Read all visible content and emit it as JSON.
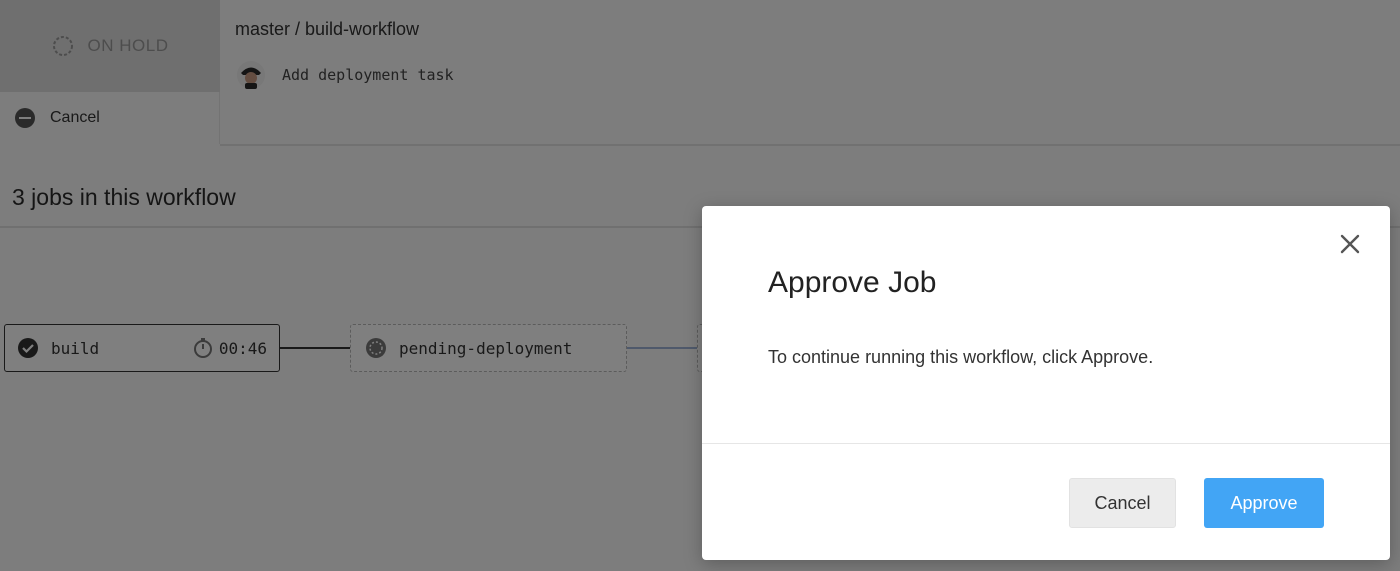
{
  "header": {
    "status_label": "ON HOLD",
    "cancel_label": "Cancel",
    "branch": "master / build-workflow",
    "commit_message": "Add deployment task"
  },
  "jobs_section": {
    "title": "3 jobs in this workflow",
    "jobs": [
      {
        "name": "build",
        "duration": "00:46",
        "status": "success"
      },
      {
        "name": "pending-deployment",
        "status": "on-hold"
      },
      {
        "name": "",
        "status": "blocked"
      }
    ]
  },
  "modal": {
    "title": "Approve Job",
    "body": "To continue running this workflow, click Approve.",
    "cancel_label": "Cancel",
    "approve_label": "Approve",
    "close_icon": "close-icon"
  },
  "colors": {
    "approve": "#42a5f5",
    "overlay": "rgba(0,0,0,0.5)"
  }
}
